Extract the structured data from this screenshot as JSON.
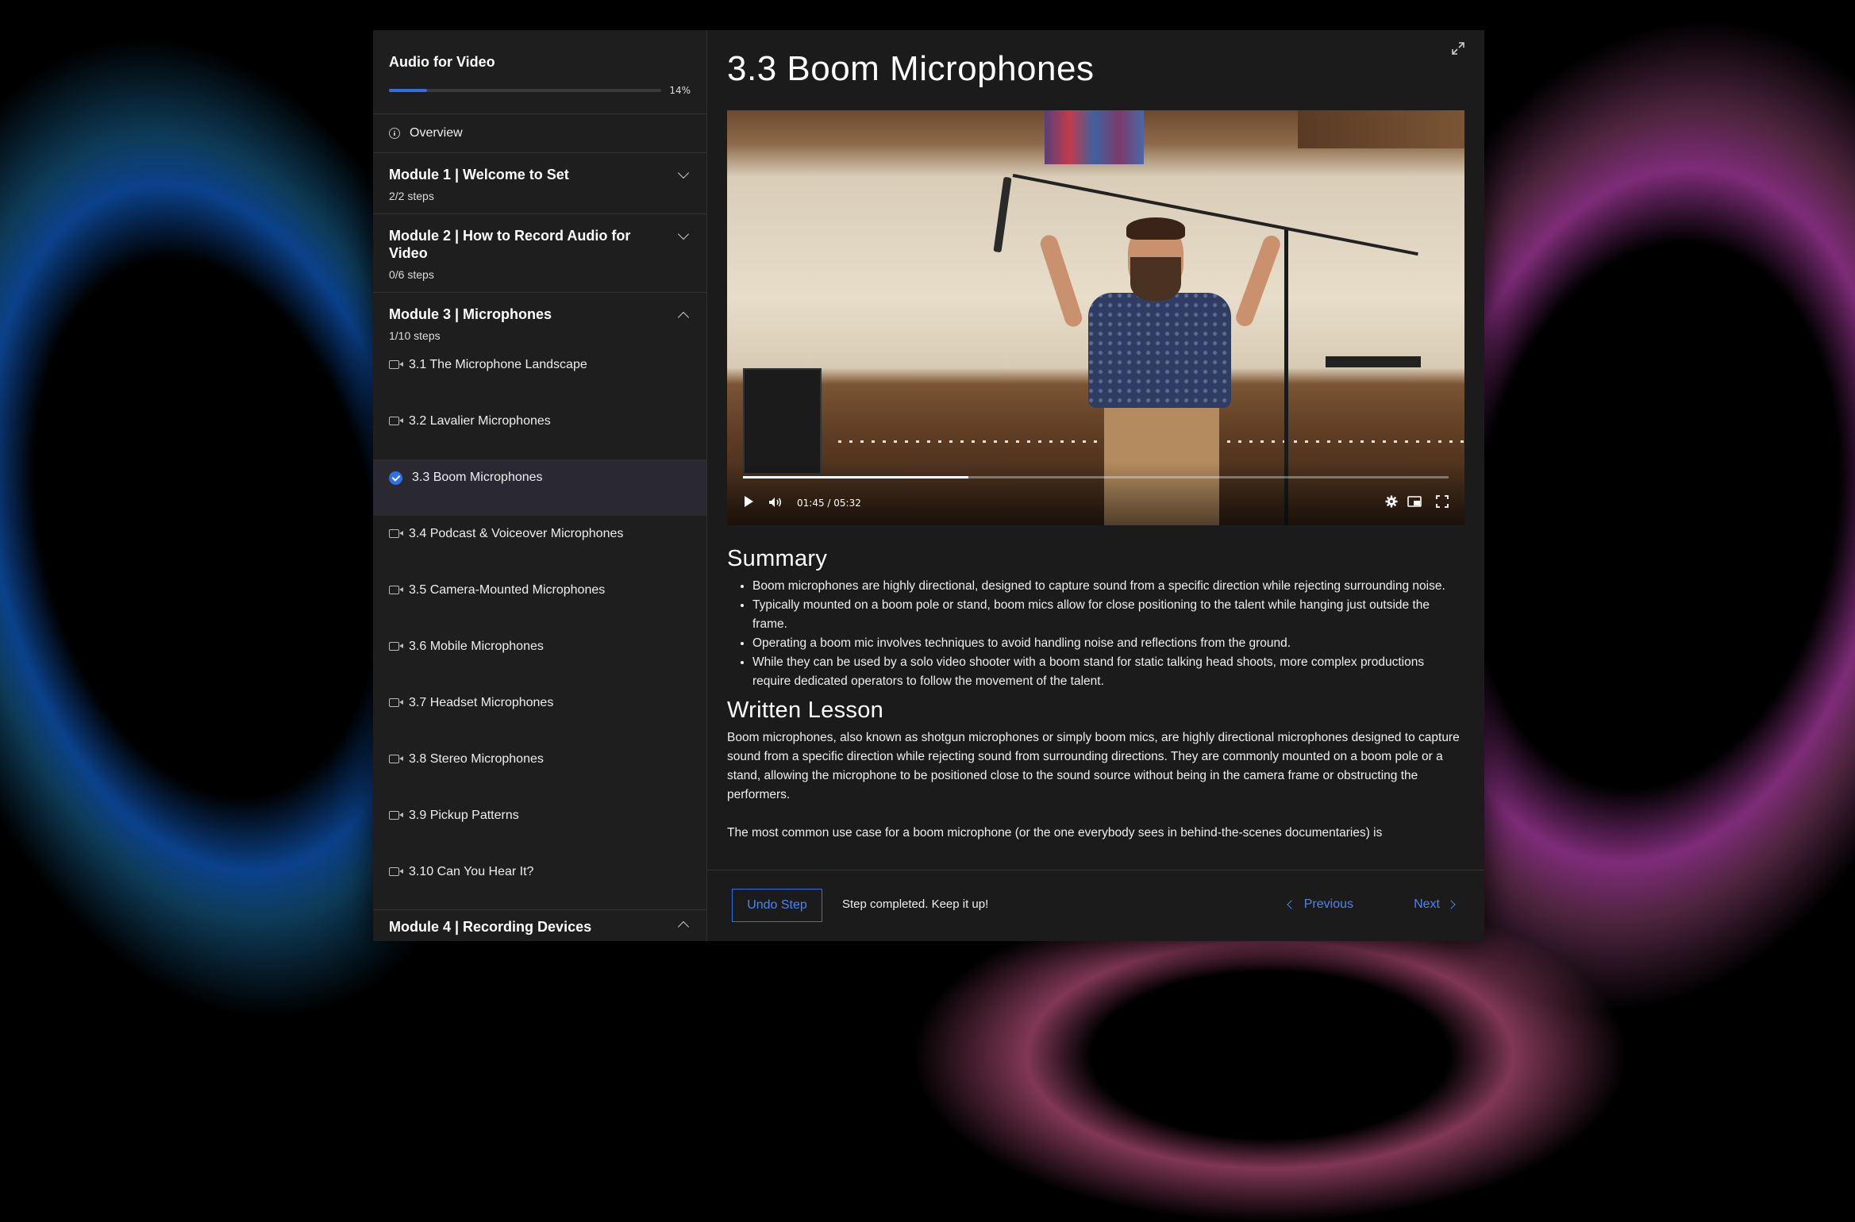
{
  "course": {
    "title": "Audio for Video",
    "progress_percent": 14,
    "progress_label": "14%"
  },
  "sidebar": {
    "overview_label": "Overview",
    "modules": [
      {
        "title": "Module 1 | Welcome to Set",
        "steps": "2/2 steps",
        "expanded": false
      },
      {
        "title": "Module 2 | How to Record Audio for Video",
        "steps": "0/6 steps",
        "expanded": false
      },
      {
        "title": "Module 3 | Microphones",
        "steps": "1/10 steps",
        "expanded": true
      }
    ],
    "lessons": [
      {
        "label": "3.1 The Microphone Landscape",
        "icon": "video-camera-icon"
      },
      {
        "label": "3.2 Lavalier Microphones",
        "icon": "video-camera-icon"
      },
      {
        "label": "3.3 Boom Microphones",
        "icon": "check-circle-icon",
        "active": true
      },
      {
        "label": "3.4 Podcast & Voiceover Microphones",
        "icon": "video-camera-icon"
      },
      {
        "label": "3.5 Camera-Mounted Microphones",
        "icon": "video-camera-icon"
      },
      {
        "label": "3.6 Mobile Microphones",
        "icon": "video-camera-icon"
      },
      {
        "label": "3.7 Headset Microphones",
        "icon": "video-camera-icon"
      },
      {
        "label": "3.8 Stereo Microphones",
        "icon": "video-camera-icon"
      },
      {
        "label": "3.9 Pickup Patterns",
        "icon": "video-camera-icon"
      },
      {
        "label": "3.10 Can You Hear It?",
        "icon": "video-camera-icon"
      }
    ],
    "next_module_title": "Module 4 | Recording Devices"
  },
  "main": {
    "title": "3.3 Boom Microphones",
    "video": {
      "timecode": "01:45 / 05:32",
      "played_fraction": 0.32
    },
    "summary_heading": "Summary",
    "summary_bullets": [
      "Boom microphones are highly directional, designed to capture sound from a specific direction while rejecting surrounding noise.",
      "Typically mounted on a boom pole or stand, boom mics allow for close positioning to the talent while hanging just outside the frame.",
      "Operating a boom mic involves techniques to avoid handling noise and reflections from the ground.",
      "While they can be used by a solo video shooter with a boom stand for static talking head shoots, more complex productions require dedicated operators to follow the movement of the talent."
    ],
    "written_heading": "Written Lesson",
    "paragraphs": [
      "Boom microphones, also known as shotgun microphones or simply boom mics, are highly directional microphones designed to capture sound from a specific direction while rejecting sound from surrounding directions. They are commonly mounted on a boom pole or a stand, allowing the microphone to be positioned close to the sound source without being in the camera frame or obstructing the performers.",
      "The most common use case for a boom microphone (or the one everybody sees in behind-the-scenes documentaries) is"
    ]
  },
  "footer": {
    "undo_label": "Undo Step",
    "status_text": "Step completed. Keep it up!",
    "previous_label": "Previous",
    "next_label": "Next"
  },
  "colors": {
    "accent": "#2f6fe8",
    "link": "#4a86f0",
    "panel": "#1b1b1c"
  }
}
